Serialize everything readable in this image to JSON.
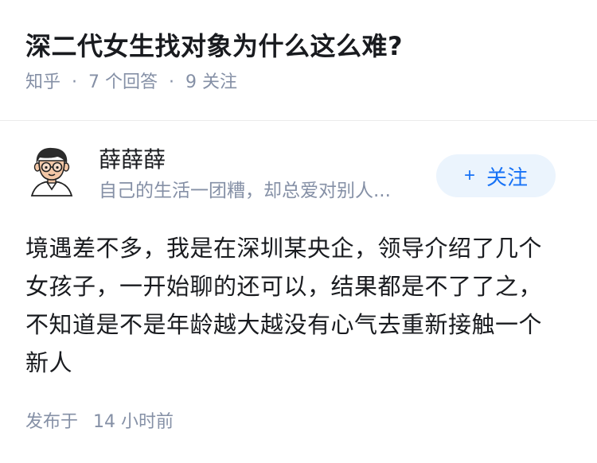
{
  "question": {
    "title": "深二代女生找对象为什么这么难?",
    "source": "知乎",
    "answers_count": "7 个回答",
    "followers_count": "9 关注"
  },
  "answer": {
    "author_name": "薛薛薛",
    "author_bio": "自己的生活一团糟，却总爱对别人...",
    "follow_label": "关注",
    "content": "境遇差不多，我是在深圳某央企，领导介绍了几个女孩子，一开始聊的还可以，结果都是不了了之，不知道是不是年龄越大越没有心气去重新接触一个新人",
    "published_prefix": "发布于",
    "published_time": "14 小时前"
  },
  "icons": {
    "avatar": "cartoon-man-avatar",
    "follow": "plus-icon"
  },
  "colors": {
    "accent": "#1772f6",
    "follow_bg": "#ebf4fd",
    "meta_text": "#8590a6",
    "main_text": "#191b1f"
  }
}
